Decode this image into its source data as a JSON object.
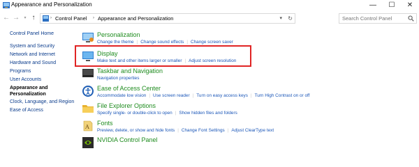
{
  "window": {
    "title": "Appearance and Personalization",
    "minimize": "—",
    "maximize": "☐",
    "close": "✕"
  },
  "nav": {
    "breadcrumbs": [
      "Control Panel",
      "Appearance and Personalization"
    ],
    "search_placeholder": "Search Control Panel"
  },
  "sidebar": {
    "items": [
      "Control Panel Home",
      "System and Security",
      "Network and Internet",
      "Hardware and Sound",
      "Programs",
      "User Accounts"
    ],
    "current_line1": "Appearance and",
    "current_line2": "Personalization",
    "items_after": [
      "Clock, Language, and Region",
      "Ease of Access"
    ]
  },
  "categories": [
    {
      "title": "Personalization",
      "icon": "personalization-icon",
      "links": [
        "Change the theme",
        "Change sound effects",
        "Change screen saver"
      ]
    },
    {
      "title": "Display",
      "icon": "display-icon",
      "links": [
        "Make text and other items larger or smaller",
        "Adjust screen resolution"
      ]
    },
    {
      "title": "Taskbar and Navigation",
      "icon": "taskbar-icon",
      "links": [
        "Navigation properties"
      ]
    },
    {
      "title": "Ease of Access Center",
      "icon": "ease-of-access-icon",
      "links": [
        "Accommodate low vision",
        "Use screen reader",
        "Turn on easy access keys",
        "Turn High Contrast on or off"
      ]
    },
    {
      "title": "File Explorer Options",
      "icon": "folder-icon",
      "links": [
        "Specify single- or double-click to open",
        "Show hidden files and folders"
      ]
    },
    {
      "title": "Fonts",
      "icon": "fonts-icon",
      "links": [
        "Preview, delete, or show and hide fonts",
        "Change Font Settings",
        "Adjust ClearType text"
      ]
    },
    {
      "title": "NVIDIA Control Panel",
      "icon": "nvidia-icon",
      "links": []
    }
  ],
  "colors": {
    "category_title": "#1f8c1f",
    "link": "#1a56b8",
    "sidebar_link": "#0b3c8c",
    "highlight_border": "#e02424"
  }
}
